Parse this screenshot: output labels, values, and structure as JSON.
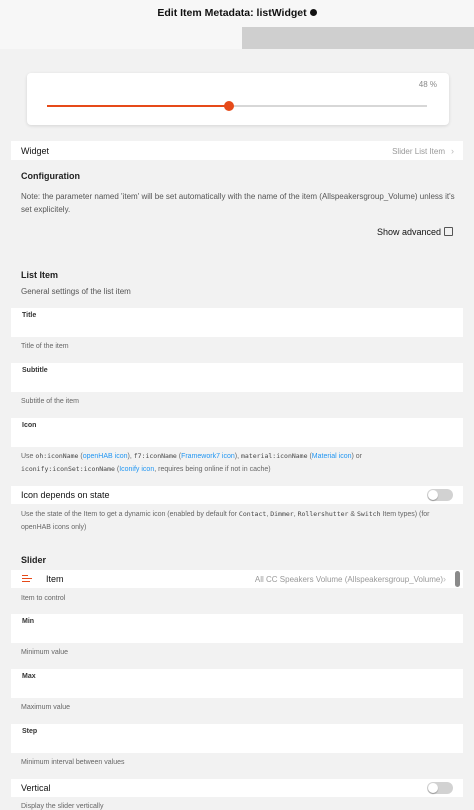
{
  "window": {
    "title": "Edit Item Metadata: listWidget"
  },
  "preview": {
    "percent_label": "48 %",
    "value_percent": 48,
    "accent": "#e64a19"
  },
  "widget_row": {
    "label": "Widget",
    "value": "Slider List Item"
  },
  "configuration": {
    "title": "Configuration",
    "note": "Note: the parameter named 'item' will be set automatically with the name of the item (Allspeakersgroup_Volume) unless it's set explicitely.",
    "show_advanced_label": "Show advanced"
  },
  "list_item": {
    "title": "List Item",
    "subtitle": "General settings of the list item",
    "fields": {
      "title": {
        "label": "Title",
        "hint": "Title of the item"
      },
      "subtitle": {
        "label": "Subtitle",
        "hint": "Subtitle of the item"
      },
      "icon": {
        "label": "Icon"
      }
    },
    "icon_hint": {
      "p1": "Use ",
      "c1": "oh:iconName",
      "p2": " (",
      "l1": "openHAB icon",
      "p3": "), ",
      "c2": "f7:iconName",
      "p4": " (",
      "l2": "Framework7 icon",
      "p5": "), ",
      "c3": "material:iconName",
      "p6": " (",
      "l3": "Material icon",
      "p7": ") or",
      "c4": "iconify:iconSet:iconName",
      "p8": " (",
      "l4": "Iconify icon",
      "p9": ", requires being online if not in cache)"
    },
    "icon_state": {
      "label": "Icon depends on state",
      "hint": {
        "p1": "Use the state of the Item to get a dynamic icon (enabled by default for ",
        "c1": "Contact",
        "p2": ", ",
        "c2": "Dimmer",
        "p3": ", ",
        "c3": "Rollershutter",
        "p4": " & ",
        "c4": "Switch",
        "p5": " Item types) (for openHAB icons only)"
      }
    }
  },
  "slider": {
    "title": "Slider",
    "item_row": {
      "label": "Item",
      "value": "All CC Speakers Volume (Allspeakersgroup_Volume)",
      "hint": "Item to control"
    },
    "fields": {
      "min": {
        "label": "Min",
        "hint": "Minimum value"
      },
      "max": {
        "label": "Max",
        "hint": "Maximum value"
      },
      "step": {
        "label": "Step",
        "hint": "Minimum interval between values"
      }
    },
    "vertical": {
      "label": "Vertical",
      "hint": "Display the slider vertically"
    }
  }
}
